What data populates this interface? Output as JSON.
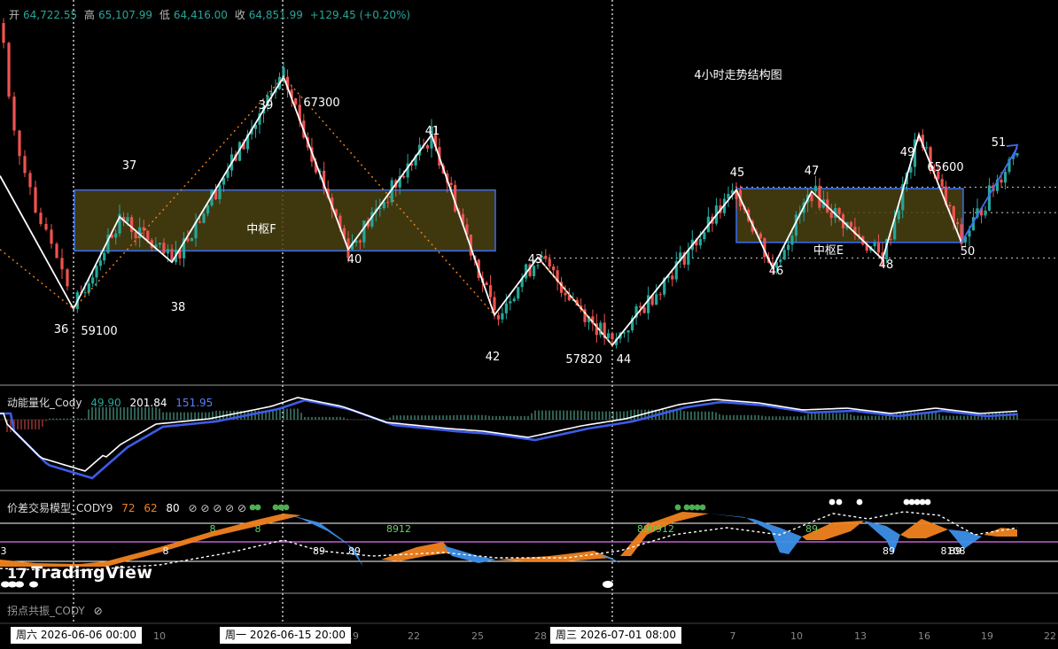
{
  "ohlc": {
    "open_label": "开",
    "open": "64,722.55",
    "high_label": "高",
    "high": "65,107.99",
    "low_label": "低",
    "low": "64,416.00",
    "close_label": "收",
    "close": "64,851.99",
    "change": "+129.45 (+0.20%)"
  },
  "chart_data": [
    {
      "type": "candlestick",
      "title": "4小时走势结构图",
      "timeframe": "4H",
      "price_range": [
        56500,
        69700
      ],
      "y_axis_shown": false,
      "grid": false,
      "stroke_points": [
        {
          "label": "36",
          "price": 59100,
          "price_label": "59100"
        },
        {
          "label": "37",
          "price": 62350
        },
        {
          "label": "38",
          "price": 60750
        },
        {
          "label": "39",
          "price": 67300,
          "price_label": "67300"
        },
        {
          "label": "40",
          "price": 61200
        },
        {
          "label": "41",
          "price": 65250
        },
        {
          "label": "42",
          "price": 58880
        },
        {
          "label": "43",
          "price": 60920
        },
        {
          "label": "44",
          "price": 57820,
          "price_label": "57820"
        },
        {
          "label": "45",
          "price": 63300
        },
        {
          "label": "46",
          "price": 60550
        },
        {
          "label": "47",
          "price": 63250
        },
        {
          "label": "48",
          "price": 60850
        },
        {
          "label": "49",
          "price": 65250
        },
        {
          "label": "50",
          "price": 61450
        },
        {
          "label": "51",
          "price": 64850
        },
        {
          "label": "65600",
          "price": 65600,
          "price_label": "65600"
        }
      ],
      "pivot_zones": [
        {
          "label": "中枢F",
          "low": 61150,
          "high": 63300
        },
        {
          "label": "中枢E",
          "low": 61450,
          "high": 63350
        }
      ],
      "dotted_levels": [
        63400,
        62500,
        60900
      ]
    },
    {
      "type": "line",
      "name": "动能量化_Cody",
      "values_shown": [
        49.9,
        201.84,
        151.95
      ],
      "series": [
        {
          "name": "fast",
          "color": "#ffffff"
        },
        {
          "name": "slow",
          "color": "#3d5ce8"
        },
        {
          "name": "histogram",
          "type": "bar"
        }
      ]
    },
    {
      "type": "area",
      "name": "价差交易模型_CODY9",
      "values_shown": [
        72,
        62,
        80
      ],
      "markers": [
        "8",
        "8",
        "8",
        "89",
        "89",
        "8912",
        "890912",
        "89",
        "89",
        "89",
        "8",
        "810",
        "3"
      ],
      "levels": {
        "upper": "white",
        "mid": "#c060d0",
        "lower": "white"
      }
    },
    {
      "type": "line",
      "name": "拐点共振_CODY",
      "values_shown": []
    }
  ],
  "time_labels": [
    {
      "text": "10"
    },
    {
      "text": "19"
    },
    {
      "text": "22"
    },
    {
      "text": "25"
    },
    {
      "text": "28"
    },
    {
      "text": "7"
    },
    {
      "text": "10"
    },
    {
      "text": "13"
    },
    {
      "text": "16"
    },
    {
      "text": "19"
    },
    {
      "text": "22"
    }
  ],
  "date_tags": [
    {
      "text": "周六 2026-06-06   00:00"
    },
    {
      "text": "周一 2026-06-15   20:00"
    },
    {
      "text": "周三 2026-07-01   08:00"
    }
  ],
  "indicator1": {
    "name": "动能量化_Cody",
    "v1": "49.90",
    "v2": "201.84",
    "v3": "151.95"
  },
  "indicator2": {
    "name": "价差交易模型_CODY9",
    "v1": "72",
    "v2": "62",
    "v3": "80",
    "icons": "⊘ ⊘ ⊘ ⊘ ⊘"
  },
  "indicator3": {
    "name": "拐点共振_CODY",
    "icon": "⊘"
  },
  "logo": {
    "text": "TradingView",
    "mark": "17"
  },
  "colors": {
    "up": "#26a69a",
    "down": "#ef5350",
    "stroke": "#ffffff",
    "zone_fill": "#4a4212",
    "zone_border": "#3b6ef0",
    "orange": "#f0821e",
    "blue": "#3d8fe8",
    "purple": "#c060d0"
  }
}
